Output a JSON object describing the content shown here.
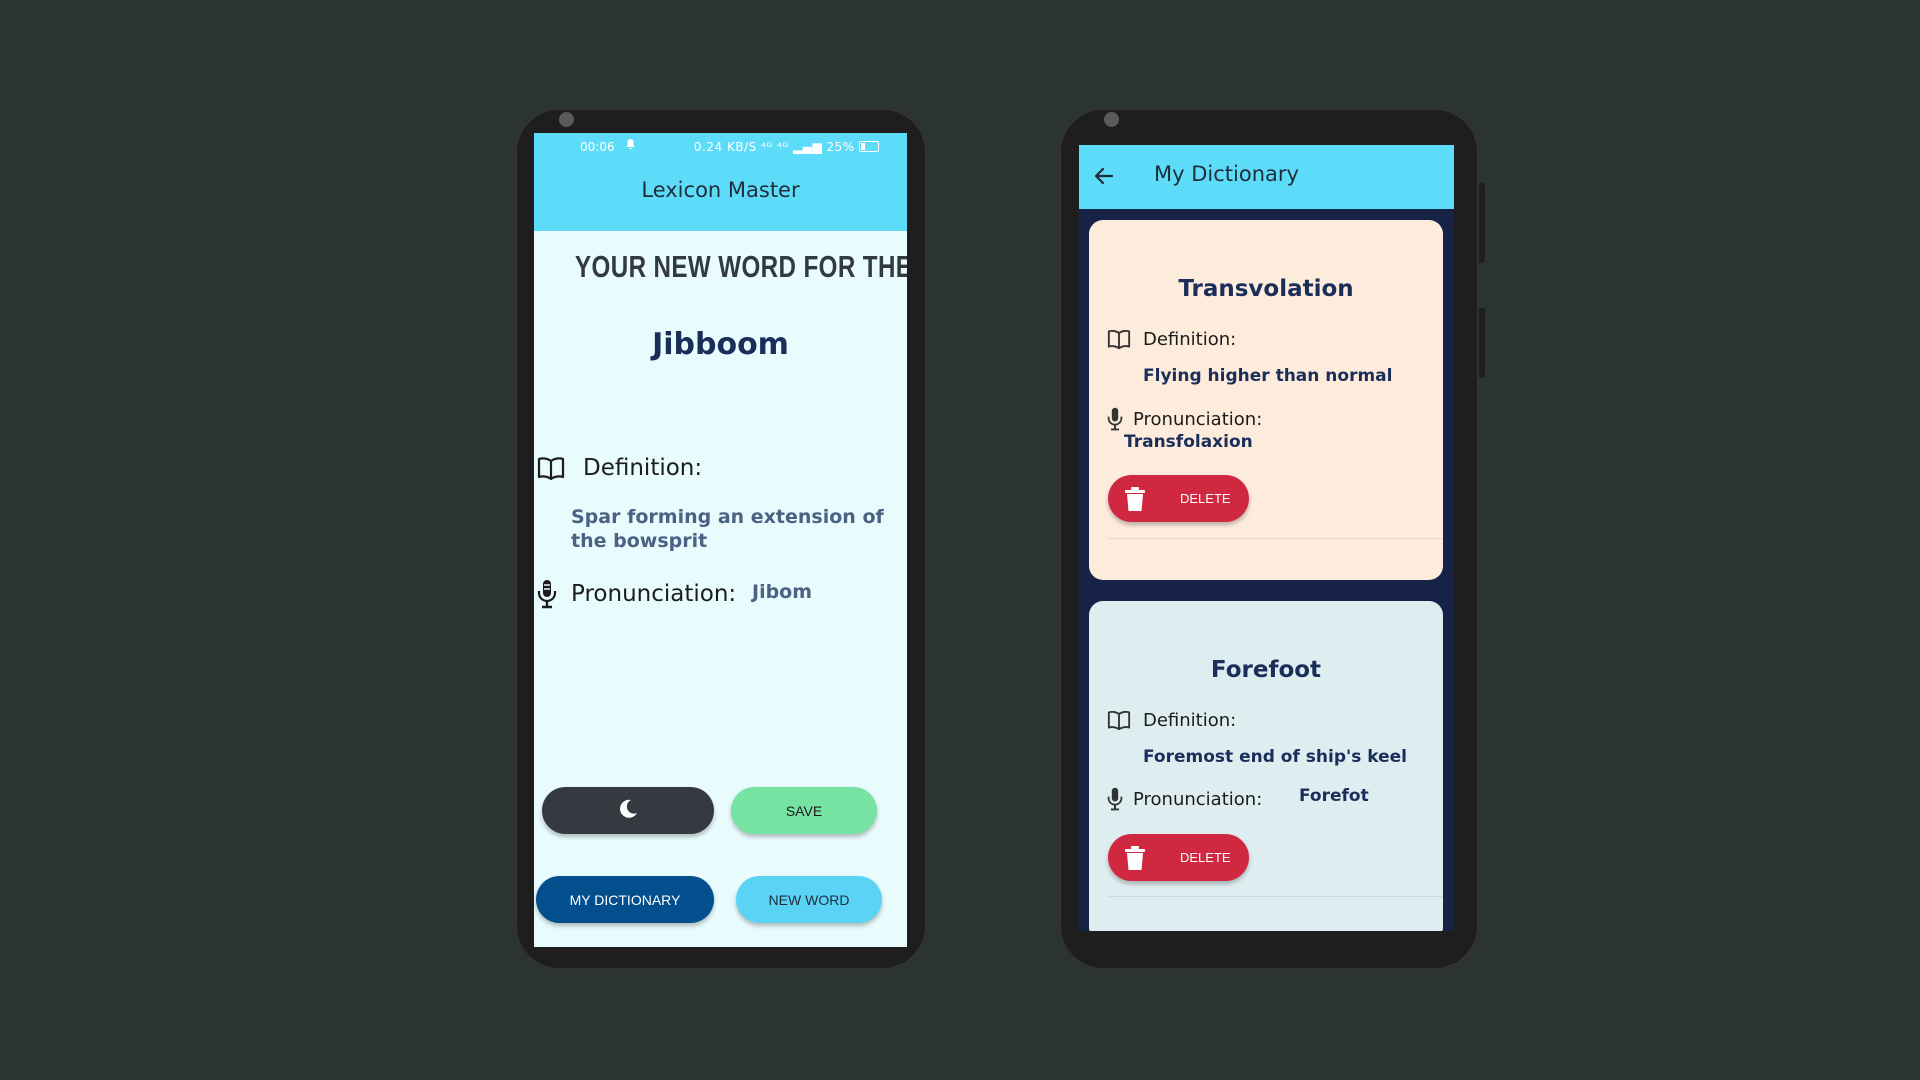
{
  "left_phone": {
    "status": {
      "time": "00:06",
      "right": "0.24 KB/S  ⁴ᴳ  ⁴ᴳ  ▂▄▆  25%"
    },
    "app_title": "Lexicon Master",
    "heading": "YOUR NEW WORD FOR THE DAY",
    "word": "Jibboom",
    "definition_label": "Definition:",
    "definition": "Spar forming an extension of the bowsprit",
    "pronunciation_label": "Pronunciation:",
    "pronunciation": "Jibom",
    "buttons": {
      "save": "SAVE",
      "my_dictionary": "MY DICTIONARY",
      "new_word": "NEW WORD"
    }
  },
  "right_phone": {
    "title": "My Dictionary",
    "entries": [
      {
        "word": "Transvolation",
        "definition_label": "Definition:",
        "definition": "Flying higher than normal",
        "pronunciation_label": "Pronunciation:",
        "pronunciation": "Transfolaxion",
        "delete_label": "DELETE"
      },
      {
        "word": "Forefoot",
        "definition_label": "Definition:",
        "definition": "Foremost end of ship's keel",
        "pronunciation_label": "Pronunciation:",
        "pronunciation": "Forefot",
        "delete_label": "DELETE"
      }
    ]
  },
  "colors": {
    "background": "#2c3333",
    "appbar": "#5ddcfa",
    "screen_bg": "#e8fbfd",
    "dark_toggle": "#343a40",
    "save": "#77e3a2",
    "my_dictionary": "#034e8c",
    "new_word": "#5ad3f5",
    "delete": "#cf2840",
    "card1": "#fdebdc",
    "card2": "#deedf0",
    "list_bg": "#162347"
  },
  "icons": [
    "book-icon",
    "microphone-icon",
    "moon-icon",
    "back-arrow-icon",
    "trash-icon",
    "bell-icon",
    "battery-icon"
  ]
}
